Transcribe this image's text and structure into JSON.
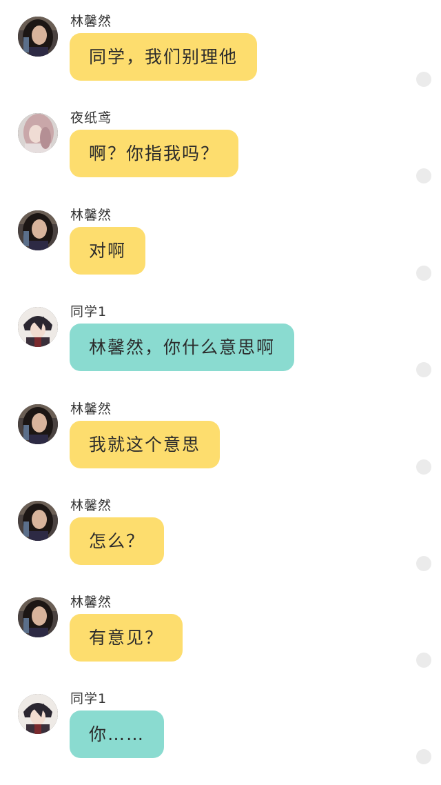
{
  "messages": [
    {
      "sender": "林馨然",
      "text": "同学，我们别理他",
      "bubble_color": "#fddd6e",
      "avatar": "girl-dark-hair-avatar"
    },
    {
      "sender": "夜纸鸢",
      "text": "啊？你指我吗？",
      "bubble_color": "#fddd6e",
      "avatar": "girl-pink-hair-avatar"
    },
    {
      "sender": "林馨然",
      "text": "对啊",
      "bubble_color": "#fddd6e",
      "avatar": "girl-dark-hair-avatar"
    },
    {
      "sender": "同学1",
      "text": "林馨然，你什么意思啊",
      "bubble_color": "#8adbd0",
      "avatar": "boy-anime-avatar"
    },
    {
      "sender": "林馨然",
      "text": "我就这个意思",
      "bubble_color": "#fddd6e",
      "avatar": "girl-dark-hair-avatar"
    },
    {
      "sender": "林馨然",
      "text": "怎么？",
      "bubble_color": "#fddd6e",
      "avatar": "girl-dark-hair-avatar"
    },
    {
      "sender": "林馨然",
      "text": "有意见？",
      "bubble_color": "#fddd6e",
      "avatar": "girl-dark-hair-avatar"
    },
    {
      "sender": "同学1",
      "text": "你……",
      "bubble_color": "#8adbd0",
      "avatar": "boy-anime-avatar"
    }
  ]
}
